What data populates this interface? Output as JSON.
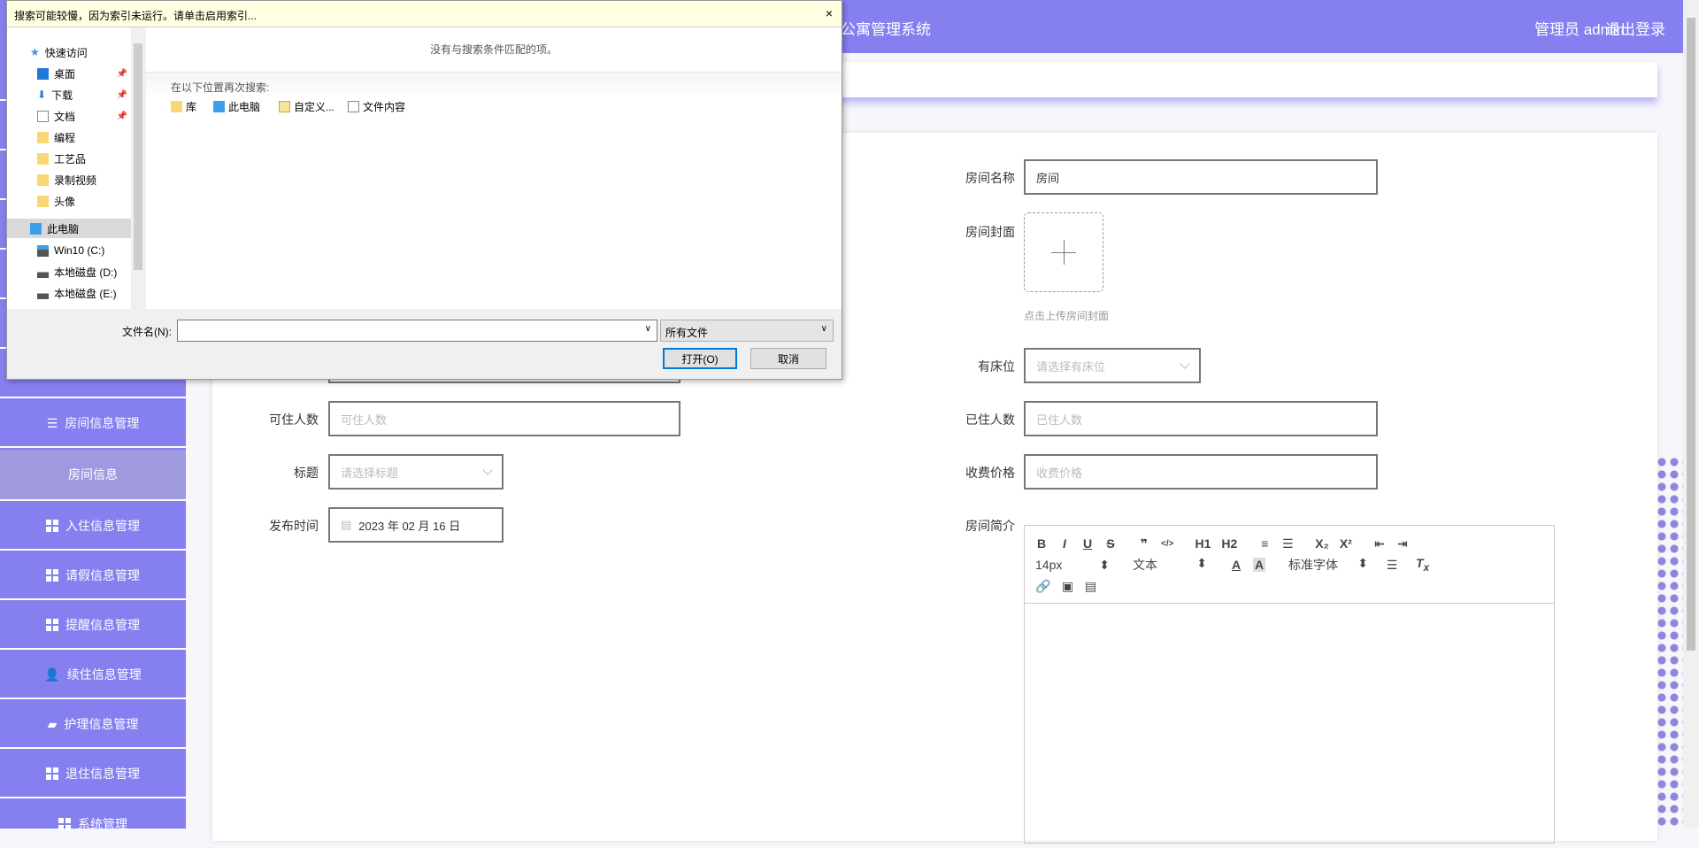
{
  "header": {
    "title": "公寓管理系统",
    "user": "管理员 admin",
    "logout": "退出登录"
  },
  "sidebar": {
    "items": [
      {
        "label": "房间信息管理"
      },
      {
        "label": "房间信息"
      },
      {
        "label": "入住信息管理"
      },
      {
        "label": "请假信息管理"
      },
      {
        "label": "提醒信息管理"
      },
      {
        "label": "续住信息管理"
      },
      {
        "label": "护理信息管理"
      },
      {
        "label": "退住信息管理"
      },
      {
        "label": "系统管理"
      }
    ]
  },
  "form": {
    "room_name": {
      "label": "房间名称",
      "value": "房间"
    },
    "room_cover": {
      "label": "房间封面",
      "hint": "点击上传房间封面"
    },
    "has_bed": {
      "label": "有床位",
      "placeholder": "请选择有床位"
    },
    "occupied": {
      "label": "已住人数",
      "placeholder": "已住人数"
    },
    "price": {
      "label": "收费价格",
      "placeholder": "收费价格"
    },
    "intro": {
      "label": "房间简介"
    },
    "capacity": {
      "label": "可住人数",
      "placeholder": "可住人数"
    },
    "title": {
      "label": "标题",
      "placeholder": "请选择标题"
    },
    "publish_time": {
      "label": "发布时间",
      "value": "2023 年 02 月 16 日"
    }
  },
  "editor": {
    "size": "14px",
    "para": "文本",
    "font": "标准字体",
    "buttons": [
      "B",
      "I",
      "U",
      "S",
      "❞",
      "</>",
      "H1",
      "H2",
      "≡",
      "☰",
      "X₂",
      "X²",
      "⇤",
      "⇥"
    ]
  },
  "dialog": {
    "infobar": "搜索可能较慢，因为索引未运行。请单击启用索引...",
    "close": "×",
    "no_items": "没有与搜索条件匹配的项。",
    "search_again": "在以下位置再次搜索:",
    "locations": [
      "库",
      "此电脑",
      "自定义...",
      "文件内容"
    ],
    "nav": [
      "快速访问",
      "桌面",
      "下载",
      "文档",
      "编程",
      "工艺品",
      "录制视频",
      "头像",
      "此电脑",
      "Win10 (C:)",
      "本地磁盘 (D:)",
      "本地磁盘 (E:)"
    ],
    "filename_label": "文件名(N):",
    "filename_value": "",
    "filter": "所有文件",
    "open": "打开(O)",
    "cancel": "取消"
  },
  "colors": {
    "brand": "#857ff0",
    "active": "#9f99e0"
  }
}
